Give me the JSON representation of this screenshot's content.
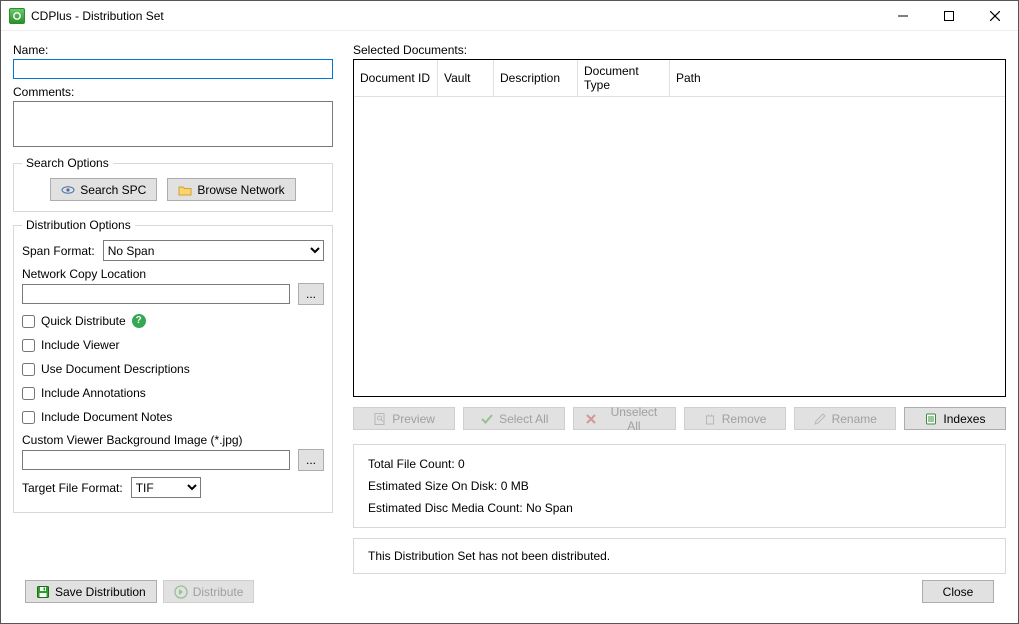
{
  "window": {
    "title": "CDPlus - Distribution Set"
  },
  "left": {
    "name_label": "Name:",
    "name_value": "",
    "comments_label": "Comments:",
    "comments_value": "",
    "search_options": {
      "legend": "Search Options",
      "search_spc": "Search SPC",
      "browse_network": "Browse Network"
    },
    "dist_options": {
      "legend": "Distribution Options",
      "span_format_label": "Span Format:",
      "span_format_value": "No Span",
      "network_copy_label": "Network Copy Location",
      "network_copy_value": "",
      "browse_btn": "...",
      "quick_distribute": "Quick Distribute",
      "include_viewer": "Include Viewer",
      "use_doc_descriptions": "Use Document Descriptions",
      "include_annotations": "Include Annotations",
      "include_doc_notes": "Include Document Notes",
      "custom_bg_label": "Custom Viewer Background Image (*.jpg)",
      "custom_bg_value": "",
      "custom_bg_browse": "...",
      "target_format_label": "Target File Format:",
      "target_format_value": "TIF"
    }
  },
  "right": {
    "selected_docs_label": "Selected Documents:",
    "columns": {
      "doc_id": "Document ID",
      "vault": "Vault",
      "description": "Description",
      "doc_type": "Document Type",
      "path": "Path"
    },
    "buttons": {
      "preview": "Preview",
      "select_all": "Select All",
      "unselect_all": "Unselect All",
      "remove": "Remove",
      "rename": "Rename",
      "indexes": "Indexes"
    },
    "stats": {
      "file_count": "Total File Count: 0",
      "size_on_disk": "Estimated Size On Disk: 0 MB",
      "disc_media": "Estimated Disc Media Count: No Span"
    },
    "status": "This Distribution Set has not been distributed."
  },
  "bottom": {
    "save": "Save Distribution",
    "distribute": "Distribute",
    "close": "Close"
  }
}
